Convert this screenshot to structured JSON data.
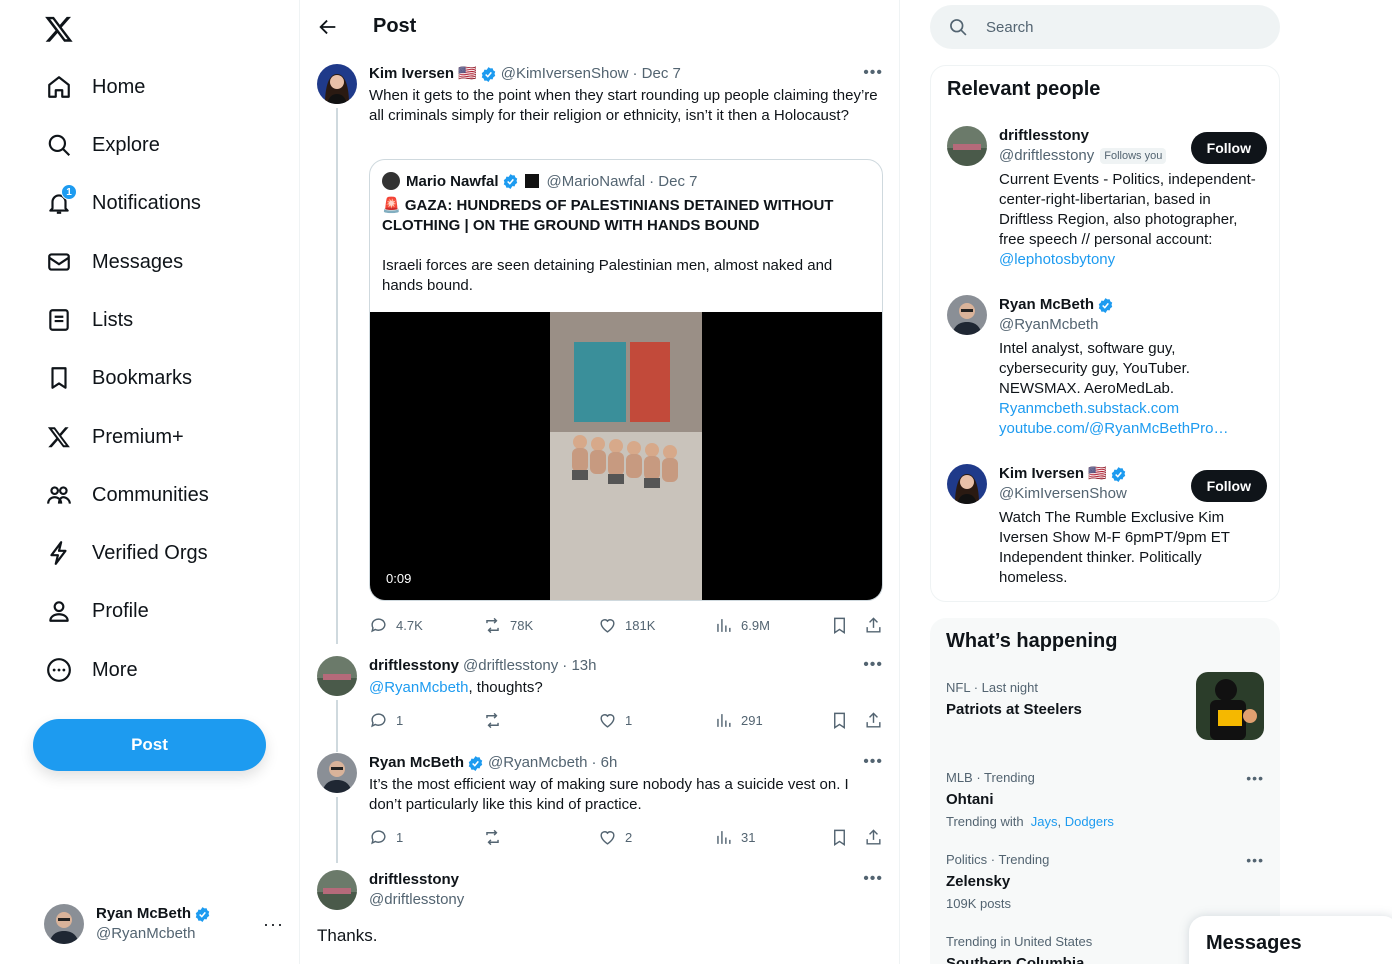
{
  "nav": {
    "items": [
      {
        "label": "Home",
        "icon": "home-icon"
      },
      {
        "label": "Explore",
        "icon": "search-icon"
      },
      {
        "label": "Notifications",
        "icon": "bell-icon",
        "badge": "1"
      },
      {
        "label": "Messages",
        "icon": "envelope-icon"
      },
      {
        "label": "Lists",
        "icon": "list-icon"
      },
      {
        "label": "Bookmarks",
        "icon": "bookmark-icon"
      },
      {
        "label": "Premium+",
        "icon": "x-logo-icon"
      },
      {
        "label": "Communities",
        "icon": "people-icon"
      },
      {
        "label": "Verified Orgs",
        "icon": "lightning-icon"
      },
      {
        "label": "Profile",
        "icon": "person-icon"
      },
      {
        "label": "More",
        "icon": "more-circle-icon"
      }
    ],
    "post_label": "Post"
  },
  "account": {
    "name": "Ryan McBeth",
    "handle": "@RyanMcbeth",
    "more": "···"
  },
  "main": {
    "title": "Post",
    "tweet": {
      "name": "Kim Iversen",
      "flag": "🇺🇸",
      "handle": "@KimIversenShow",
      "date": "· Dec 7",
      "text": "When it gets to the point when they start rounding up people claiming they’re all criminals simply for their religion or ethnicity, isn’t it then a Holocaust?",
      "quote": {
        "name": "Mario Nawfal",
        "handle": "@MarioNawfal",
        "date": "· Dec 7",
        "headline": "🚨 GAZA: HUNDREDS OF PALESTINIANS DETAINED WITHOUT CLOTHING | ON THE GROUND WITH HANDS BOUND",
        "text": "Israeli forces are seen detaining Palestinian men, almost naked and hands bound.",
        "video_time": "0:09"
      },
      "stats": {
        "replies": "4.7K",
        "reposts": "78K",
        "likes": "181K",
        "views": "6.9M"
      }
    },
    "replies": [
      {
        "name": "driftlesstony",
        "handle": "@driftlesstony",
        "time": "· 13h",
        "mention": "@RyanMcbeth",
        "text": ", thoughts?",
        "stats": {
          "replies": "1",
          "reposts": "",
          "likes": "1",
          "views": "291"
        }
      },
      {
        "name": "Ryan McBeth",
        "handle": "@RyanMcbeth",
        "time": "· 6h",
        "text": "It’s the most efficient way of making sure nobody has a suicide vest on. I don’t particularly like this kind of practice.",
        "stats": {
          "replies": "1",
          "reposts": "",
          "likes": "2",
          "views": "31"
        }
      },
      {
        "name": "driftlesstony",
        "handle": "@driftlesstony",
        "text": "Thanks."
      }
    ]
  },
  "search": {
    "placeholder": "Search"
  },
  "relevant": {
    "title": "Relevant people",
    "people": [
      {
        "name": "driftlesstony",
        "handle": "@driftlesstony",
        "follows_you": "Follows you",
        "bio": "Current Events - Politics, independent-center-right-libertarian, based in Driftless Region, also photographer, free speech // personal account: ",
        "bio_link": "@lephotosbytony",
        "follow": "Follow"
      },
      {
        "name": "Ryan McBeth",
        "handle": "@RyanMcbeth",
        "bio": "Intel analyst, software guy, cybersecurity guy, YouTuber. NEWSMAX. AeroMedLab.",
        "link1": "Ryanmcbeth.substack.com",
        "link2": "youtube.com/@RyanMcBethPro…"
      },
      {
        "name": "Kim Iversen",
        "flag": "🇺🇸",
        "handle": "@KimIversenShow",
        "bio": "Watch The Rumble Exclusive Kim Iversen Show M-F 6pmPT/9pm ET Independent thinker. Politically homeless.",
        "follow": "Follow"
      }
    ]
  },
  "happening": {
    "title": "What’s happening",
    "trends": [
      {
        "meta": "NFL · Last night",
        "name": "Patriots at Steelers"
      },
      {
        "meta": "MLB · Trending",
        "name": "Ohtani",
        "sub_prefix": "Trending with",
        "sub_link1": "Jays",
        "sub_link2": "Dodgers"
      },
      {
        "meta": "Politics · Trending",
        "name": "Zelensky",
        "sub": "109K posts"
      },
      {
        "meta": "Trending in United States",
        "name": "Southern Columbia"
      }
    ]
  },
  "messages_drawer": {
    "label": "Messages"
  },
  "colors": {
    "accent": "#1d9bf0",
    "text": "#0f1419",
    "muted": "#536471"
  }
}
